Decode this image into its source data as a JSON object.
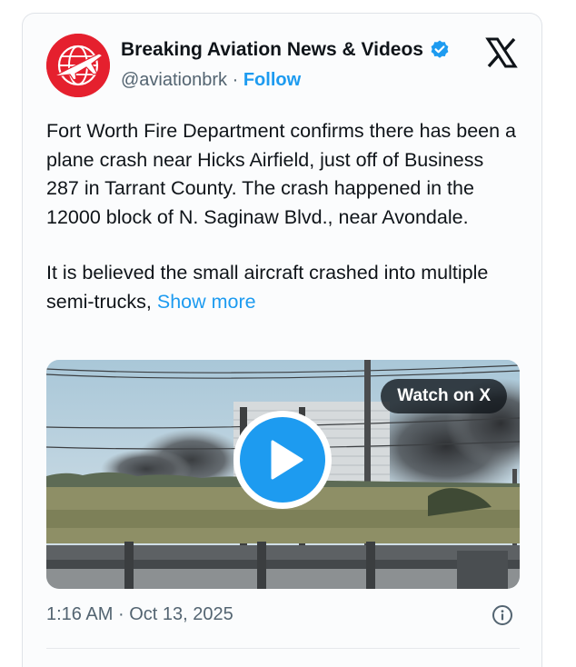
{
  "tweet": {
    "author": {
      "display_name": "Breaking Aviation News & Videos",
      "handle": "@aviationbrk",
      "separator": "·",
      "follow_label": "Follow",
      "verified": true,
      "avatar_icon": "globe-airplane-icon",
      "avatar_color": "#e5202e"
    },
    "platform_icon": "x-logo-icon",
    "body": {
      "paragraph_1": "Fort Worth Fire Department confirms there has been a plane crash near Hicks Airfield, just off of Business 287 in Tarrant County. The crash happened in the 12000 block of N. Saginaw Blvd., near Avondale.",
      "paragraph_2": "It is believed the small aircraft crashed into multiple semi-trucks,",
      "show_more_label": "Show more"
    },
    "media": {
      "type": "video",
      "watch_label": "Watch on X",
      "play_icon": "play-icon"
    },
    "footer": {
      "time": "1:16 AM",
      "separator": "·",
      "date": "Oct 13, 2025",
      "info_icon": "info-icon"
    },
    "colors": {
      "accent": "#1d9bf0",
      "text_primary": "#0f1419",
      "text_secondary": "#536471"
    }
  }
}
